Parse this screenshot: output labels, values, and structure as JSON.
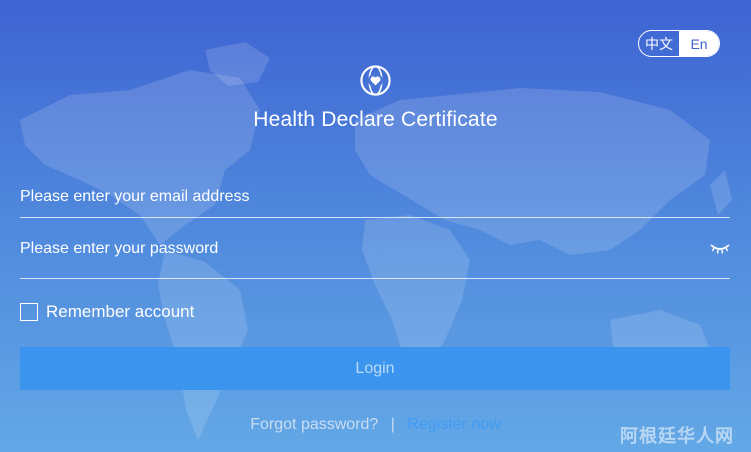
{
  "language_switch": {
    "options": [
      "中文",
      "En"
    ],
    "active": "En"
  },
  "header": {
    "logo_icon": "globe-heart-icon",
    "title": "Health Declare Certificate"
  },
  "form": {
    "email_placeholder": "Please enter your email address",
    "password_placeholder": "Please enter your password",
    "password_toggle_icon": "eye-closed-icon",
    "remember_label": "Remember account",
    "login_label": "Login"
  },
  "links": {
    "forgot_password": "Forgot password?",
    "separator": "|",
    "register": "Register now"
  },
  "watermark": "阿根廷华人网",
  "colors": {
    "background_top": "#3e63d2",
    "background_bottom": "#63a8e6",
    "login_button": "#3b95ee",
    "register_link": "#3e9cf4",
    "active_language": "#ffffff"
  }
}
